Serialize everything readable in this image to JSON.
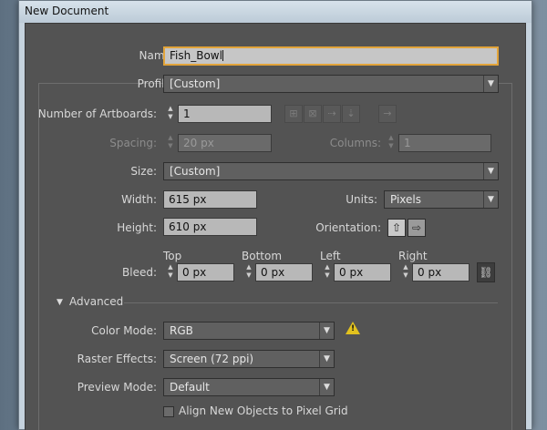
{
  "window": {
    "title": "New Document"
  },
  "form": {
    "name": {
      "label": "Name:",
      "value": "Fish_Bowl"
    },
    "profile": {
      "label": "Profile:",
      "value": "[Custom]"
    },
    "artboards": {
      "label": "Number of Artboards:",
      "value": "1"
    },
    "spacing": {
      "label": "Spacing:",
      "value": "20 px"
    },
    "columns": {
      "label": "Columns:",
      "value": "1"
    },
    "size": {
      "label": "Size:",
      "value": "[Custom]"
    },
    "width": {
      "label": "Width:",
      "value": "615 px"
    },
    "units": {
      "label": "Units:",
      "value": "Pixels"
    },
    "height": {
      "label": "Height:",
      "value": "610 px"
    },
    "orientation": {
      "label": "Orientation:",
      "selected": "portrait"
    },
    "bleed": {
      "label": "Bleed:",
      "top": {
        "label": "Top",
        "value": "0 px"
      },
      "bottom": {
        "label": "Bottom",
        "value": "0 px"
      },
      "left": {
        "label": "Left",
        "value": "0 px"
      },
      "right": {
        "label": "Right",
        "value": "0 px"
      }
    },
    "advanced": {
      "label": "Advanced",
      "expanded": true,
      "color_mode": {
        "label": "Color Mode:",
        "value": "RGB",
        "warning_icon": "warning-icon"
      },
      "raster_effects": {
        "label": "Raster Effects:",
        "value": "Screen (72 ppi)"
      },
      "preview_mode": {
        "label": "Preview Mode:",
        "value": "Default"
      },
      "pixel_grid": {
        "label": "Align New Objects to Pixel Grid",
        "checked": false
      }
    }
  },
  "colors": {
    "panel": "#535353",
    "focus_border": "#e2a43a",
    "warning": "#e2c21e"
  }
}
